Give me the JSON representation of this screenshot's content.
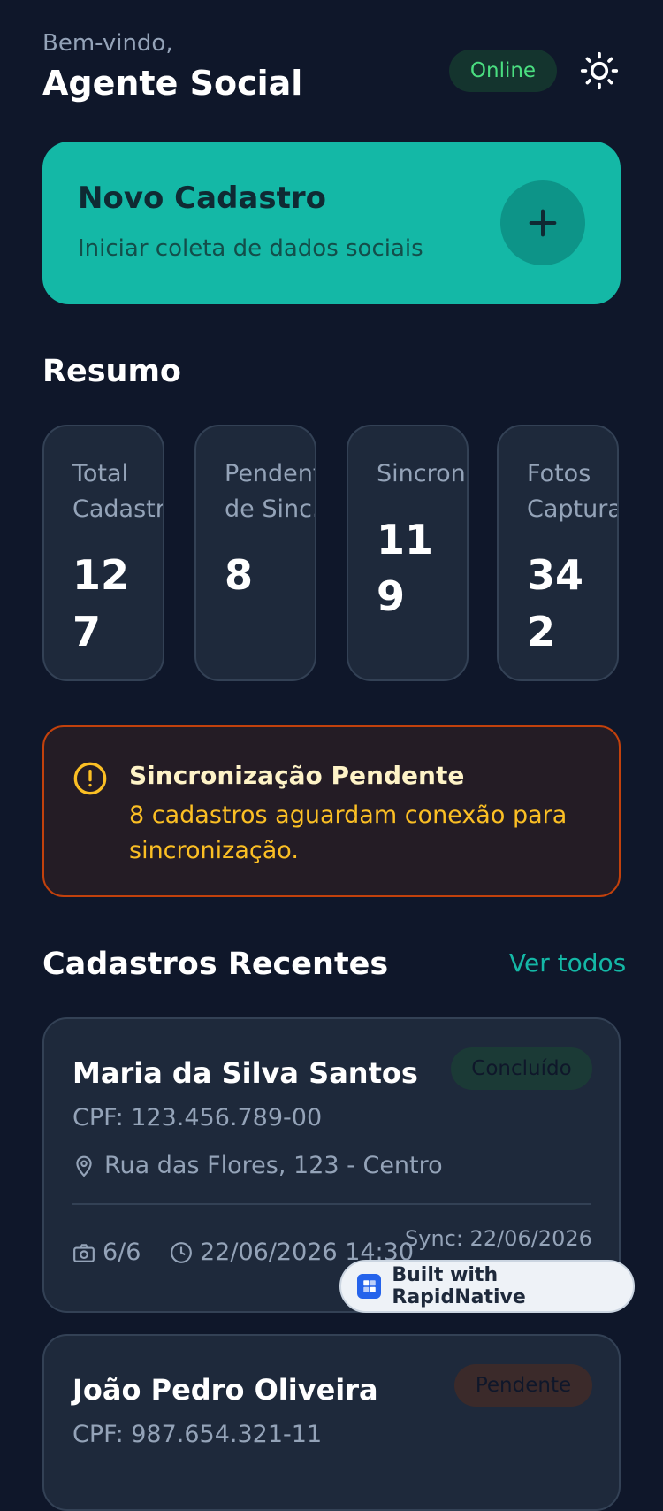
{
  "header": {
    "greeting": "Bem-vindo,",
    "user_name": "Agente Social",
    "status": "Online"
  },
  "new_card": {
    "title": "Novo Cadastro",
    "subtitle": "Iniciar coleta de dados sociais"
  },
  "summary": {
    "title": "Resumo",
    "stats": [
      {
        "label": "Total Cadastrados",
        "value": "127"
      },
      {
        "label": "Pendentes de Sinc.",
        "value": "8"
      },
      {
        "label": "Sincronizados",
        "value": "119"
      },
      {
        "label": "Fotos Capturadas",
        "value": "342"
      }
    ]
  },
  "alert": {
    "title": "Sincronização Pendente",
    "text": "8 cadastros aguardam conexão para sincronização."
  },
  "recent": {
    "title": "Cadastros Recentes",
    "see_all": "Ver todos",
    "items": [
      {
        "name": "Maria da Silva Santos",
        "status": "Concluído",
        "cpf": "CPF: 123.456.789-00",
        "address": "Rua das Flores, 123 - Centro",
        "photos": "6/6",
        "datetime": "22/06/2026 14:30",
        "sync": "Sync: 22/06/2026"
      },
      {
        "name": "João Pedro Oliveira",
        "status": "Pendente",
        "cpf": "CPF: 987.654.321-11"
      }
    ]
  },
  "built_with": "Built with RapidNative",
  "colors": {
    "background": "#0f172a",
    "accent": "#14b8a6",
    "card": "#1e293b",
    "online": "#4ade80",
    "warning": "#fbbf24",
    "done_badge": "#1b3a36",
    "pending_badge": "#3b2a2a"
  }
}
